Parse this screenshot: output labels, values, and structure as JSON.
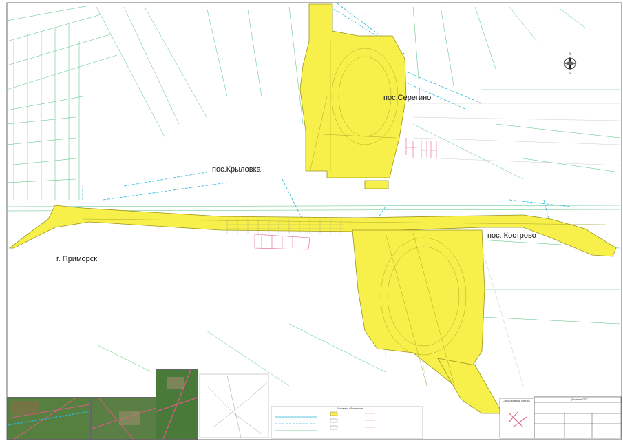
{
  "places": {
    "seregino": "пос.Серегино",
    "krylovka": "пос.Крыловка",
    "kostrovo": "пос. Кострово",
    "primorsk": "г. Приморск"
  },
  "compass": {
    "north": "N",
    "south": "S"
  },
  "legend": {
    "title": "Условные обозначения"
  },
  "scheme": {
    "title": "Схема привязки участка"
  },
  "stamp": {
    "caption": "Документ ППТ"
  },
  "colors": {
    "zone_fill": "#f7f04a",
    "zone_stroke": "#9a9420",
    "cadastre_line": "#4fc07a",
    "water_line": "#29b6d8",
    "parcel_line": "#e05a8a",
    "inset_photo": "#4f7a3e"
  }
}
